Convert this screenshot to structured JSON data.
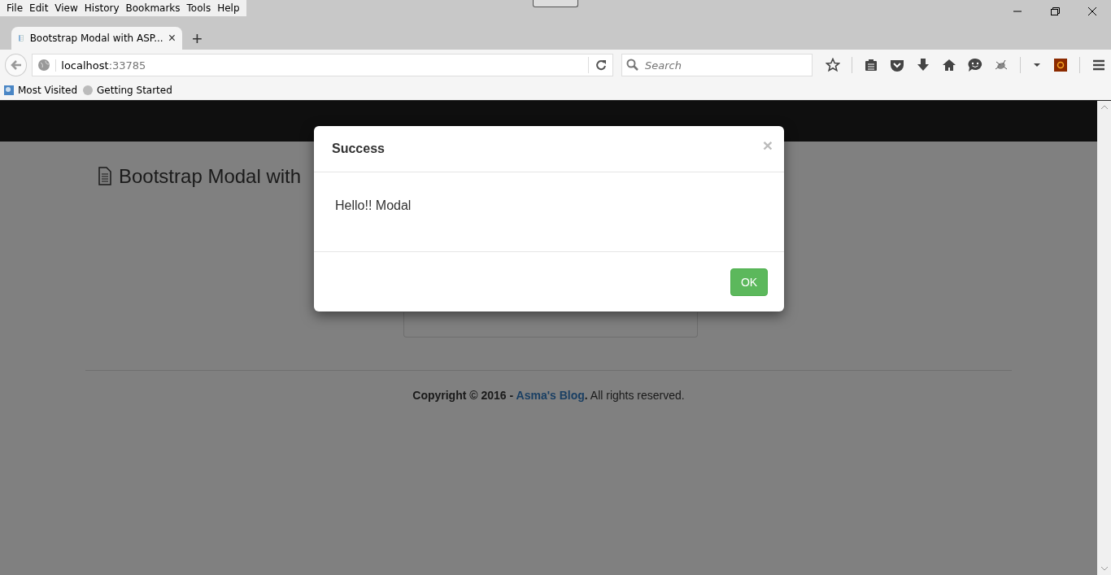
{
  "menu": [
    "File",
    "Edit",
    "View",
    "History",
    "Bookmarks",
    "Tools",
    "Help"
  ],
  "tab": {
    "title": "Bootstrap Modal with ASP...",
    "close": "×",
    "new_tab": "+"
  },
  "address": {
    "host": "localhost",
    "port": ":33785"
  },
  "search": {
    "placeholder": "Search"
  },
  "bookmarks": [
    "Most Visited",
    "Getting Started"
  ],
  "page": {
    "heading": "Bootstrap Modal with",
    "footer": {
      "prefix": "Copyright © 2016 - ",
      "link": "Asma's Blog",
      "suffix": "**.** All rights reserved."
    }
  },
  "modal": {
    "title": "Success",
    "close": "×",
    "body": "Hello!! Modal",
    "button": "OK"
  }
}
